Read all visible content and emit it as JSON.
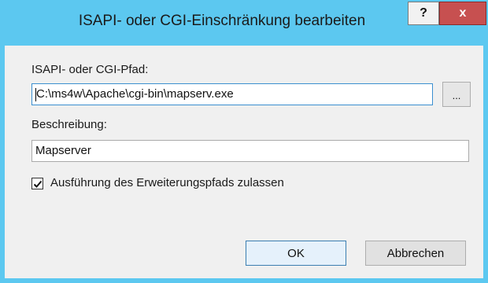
{
  "window": {
    "title": "ISAPI- oder CGI-Einschränkung bearbeiten",
    "help_label": "?",
    "close_label": "x"
  },
  "form": {
    "path_label": "ISAPI- oder CGI-Pfad:",
    "path_value": "C:\\ms4w\\Apache\\cgi-bin\\mapserv.exe",
    "browse_label": "...",
    "description_label": "Beschreibung:",
    "description_value": "Mapserver",
    "allow_extension_path_label": "Ausführung des Erweiterungspfads zulassen",
    "allow_extension_path_checked": true
  },
  "buttons": {
    "ok_label": "OK",
    "cancel_label": "Abbrechen"
  },
  "colors": {
    "titlebar": "#5cc8f0",
    "close_button": "#c75050",
    "client_background": "#f0f0f0",
    "focus_border": "#3b8fd0"
  }
}
